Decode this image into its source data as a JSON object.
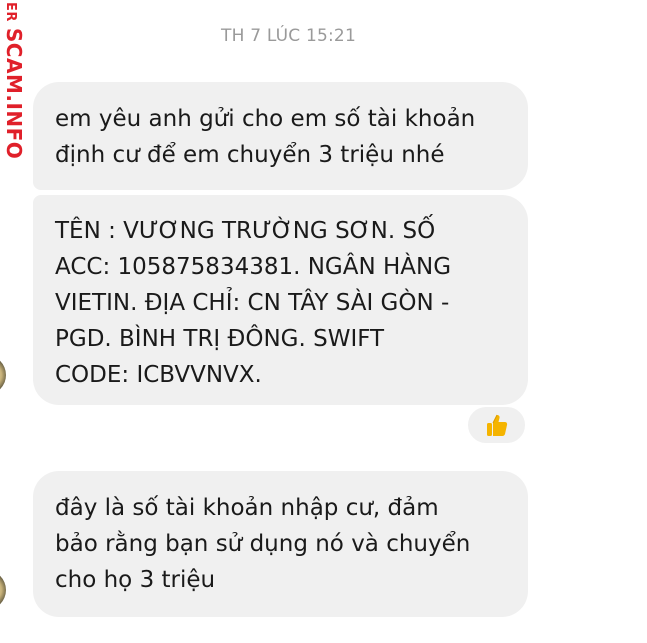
{
  "watermark": {
    "prefix": "ER",
    "main": "SCAM.INFO",
    "color": "#e0202a"
  },
  "timestamp": "TH 7 LÚC 15:21",
  "messages": [
    {
      "lines": [
        "em yêu anh gửi cho em số tài khoản",
        "định cư để em chuyển 3 triệu nhé"
      ]
    },
    {
      "lines": [
        "TÊN : VƯƠNG TRƯỜNG SƠN.   SỐ",
        "ACC: 105875834381.  NGÂN HÀNG",
        "VIETIN.   ĐỊA CHỈ: CN TÂY SÀI GÒN -",
        "PGD. BÌNH TRỊ ĐÔNG.   SWIFT",
        "CODE: ICBVVNVX."
      ]
    },
    {
      "lines": [
        "đây là số tài khoản nhập cư,  đảm",
        "bảo rằng bạn sử dụng nó và chuyển",
        "cho họ 3 triệu"
      ]
    }
  ],
  "reaction": {
    "icon": "thumbs-up-icon",
    "color": "#f5b400"
  },
  "colors": {
    "bubble": "#f0f0f0",
    "timestamp": "#9a9a9a"
  }
}
